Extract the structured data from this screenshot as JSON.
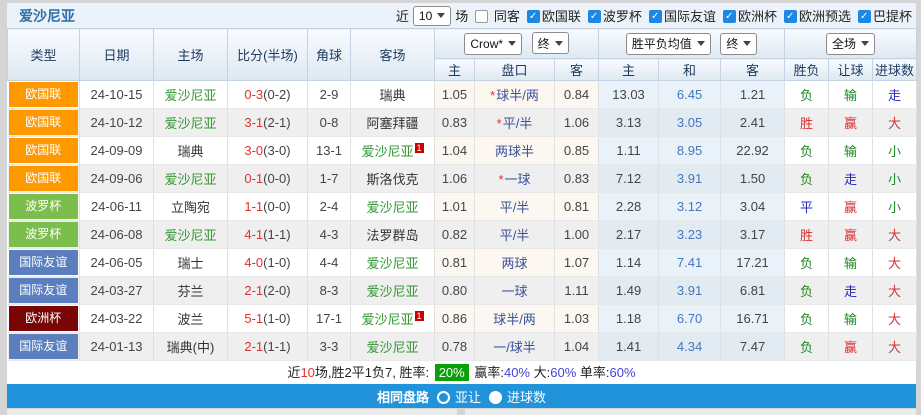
{
  "header": {
    "title": "爱沙尼亚"
  },
  "filters": {
    "recent_label": "近",
    "recent_count": "10",
    "recent_suffix": "场",
    "same_away": {
      "label": "同客",
      "checked": false
    },
    "leagues": [
      {
        "label": "欧国联",
        "checked": true
      },
      {
        "label": "波罗杯",
        "checked": true
      },
      {
        "label": "国际友谊",
        "checked": true
      },
      {
        "label": "欧洲杯",
        "checked": true
      },
      {
        "label": "欧洲预选",
        "checked": true
      },
      {
        "label": "巴提杯",
        "checked": true
      }
    ]
  },
  "selectors": {
    "asia_company": "Crow*",
    "asia_time": "终",
    "europe_mode": "胜平负均值",
    "europe_time": "终",
    "scope": "全场"
  },
  "columns": [
    "类型",
    "日期",
    "主场",
    "比分(半场)",
    "角球",
    "客场",
    "主",
    "盘口",
    "客",
    "主",
    "和",
    "客",
    "胜负",
    "让球",
    "进球数"
  ],
  "league_colors": {
    "欧国联": "#FF9900",
    "波罗杯": "#7CBE4B",
    "国际友谊": "#5B7FBE",
    "欧洲杯": "#7A0505"
  },
  "result_colors": {
    "g": "#1F8A1F",
    "r": "#D93030",
    "b": "#2525C0"
  },
  "rows": [
    {
      "type": "欧国联",
      "date": "24-10-15",
      "home": "爱沙尼亚",
      "home_green": true,
      "score": "0-3",
      "half": "(0-2)",
      "corner": "2-9",
      "away": "瑞典",
      "away_green": false,
      "red_card": "",
      "asia_home": "1.05",
      "star": "*",
      "line": "球半/两",
      "asia_away": "0.84",
      "eu_home": "13.03",
      "eu_draw": "6.45",
      "eu_away": "1.21",
      "result": "负",
      "result_c": "g",
      "handicap": "输",
      "handicap_c": "g",
      "goals": "走",
      "goals_c": "b"
    },
    {
      "type": "欧国联",
      "date": "24-10-12",
      "home": "爱沙尼亚",
      "home_green": true,
      "score": "3-1",
      "half": "(2-1)",
      "corner": "0-8",
      "away": "阿塞拜疆",
      "away_green": false,
      "red_card": "",
      "asia_home": "0.83",
      "star": "*",
      "line": "平/半",
      "asia_away": "1.06",
      "eu_home": "3.13",
      "eu_draw": "3.05",
      "eu_away": "2.41",
      "result": "胜",
      "result_c": "r",
      "handicap": "赢",
      "handicap_c": "r",
      "goals": "大",
      "goals_c": "r"
    },
    {
      "type": "欧国联",
      "date": "24-09-09",
      "home": "瑞典",
      "home_green": false,
      "score": "3-0",
      "half": "(3-0)",
      "corner": "13-1",
      "away": "爱沙尼亚",
      "away_green": true,
      "red_card": "1",
      "asia_home": "1.04",
      "star": "",
      "line": "两球半",
      "asia_away": "0.85",
      "eu_home": "1.11",
      "eu_draw": "8.95",
      "eu_away": "22.92",
      "result": "负",
      "result_c": "g",
      "handicap": "输",
      "handicap_c": "g",
      "goals": "小",
      "goals_c": "g"
    },
    {
      "type": "欧国联",
      "date": "24-09-06",
      "home": "爱沙尼亚",
      "home_green": true,
      "score": "0-1",
      "half": "(0-0)",
      "corner": "1-7",
      "away": "斯洛伐克",
      "away_green": false,
      "red_card": "",
      "asia_home": "1.06",
      "star": "*",
      "line": "一球",
      "asia_away": "0.83",
      "eu_home": "7.12",
      "eu_draw": "3.91",
      "eu_away": "1.50",
      "result": "负",
      "result_c": "g",
      "handicap": "走",
      "handicap_c": "b",
      "goals": "小",
      "goals_c": "g"
    },
    {
      "type": "波罗杯",
      "date": "24-06-11",
      "home": "立陶宛",
      "home_green": false,
      "score": "1-1",
      "half": "(0-0)",
      "corner": "2-4",
      "away": "爱沙尼亚",
      "away_green": true,
      "red_card": "",
      "asia_home": "1.01",
      "star": "",
      "line": "平/半",
      "asia_away": "0.81",
      "eu_home": "2.28",
      "eu_draw": "3.12",
      "eu_away": "3.04",
      "result": "平",
      "result_c": "b",
      "handicap": "赢",
      "handicap_c": "r",
      "goals": "小",
      "goals_c": "g"
    },
    {
      "type": "波罗杯",
      "date": "24-06-08",
      "home": "爱沙尼亚",
      "home_green": true,
      "score": "4-1",
      "half": "(1-1)",
      "corner": "4-3",
      "away": "法罗群岛",
      "away_green": false,
      "red_card": "",
      "asia_home": "0.82",
      "star": "",
      "line": "平/半",
      "asia_away": "1.00",
      "eu_home": "2.17",
      "eu_draw": "3.23",
      "eu_away": "3.17",
      "result": "胜",
      "result_c": "r",
      "handicap": "赢",
      "handicap_c": "r",
      "goals": "大",
      "goals_c": "r"
    },
    {
      "type": "国际友谊",
      "date": "24-06-05",
      "home": "瑞士",
      "home_green": false,
      "score": "4-0",
      "half": "(1-0)",
      "corner": "4-4",
      "away": "爱沙尼亚",
      "away_green": true,
      "red_card": "",
      "asia_home": "0.81",
      "star": "",
      "line": "两球",
      "asia_away": "1.07",
      "eu_home": "1.14",
      "eu_draw": "7.41",
      "eu_away": "17.21",
      "result": "负",
      "result_c": "g",
      "handicap": "输",
      "handicap_c": "g",
      "goals": "大",
      "goals_c": "r"
    },
    {
      "type": "国际友谊",
      "date": "24-03-27",
      "home": "芬兰",
      "home_green": false,
      "score": "2-1",
      "half": "(2-0)",
      "corner": "8-3",
      "away": "爱沙尼亚",
      "away_green": true,
      "red_card": "",
      "asia_home": "0.80",
      "star": "",
      "line": "一球",
      "asia_away": "1.11",
      "eu_home": "1.49",
      "eu_draw": "3.91",
      "eu_away": "6.81",
      "result": "负",
      "result_c": "g",
      "handicap": "走",
      "handicap_c": "b",
      "goals": "大",
      "goals_c": "r"
    },
    {
      "type": "欧洲杯",
      "date": "24-03-22",
      "home": "波兰",
      "home_green": false,
      "score": "5-1",
      "half": "(1-0)",
      "corner": "17-1",
      "away": "爱沙尼亚",
      "away_green": true,
      "red_card": "1",
      "asia_home": "0.86",
      "star": "",
      "line": "球半/两",
      "asia_away": "1.03",
      "eu_home": "1.18",
      "eu_draw": "6.70",
      "eu_away": "16.71",
      "result": "负",
      "result_c": "g",
      "handicap": "输",
      "handicap_c": "g",
      "goals": "大",
      "goals_c": "r"
    },
    {
      "type": "国际友谊",
      "date": "24-01-13",
      "home": "瑞典(中)",
      "home_green": false,
      "score": "2-1",
      "half": "(1-1)",
      "corner": "3-3",
      "away": "爱沙尼亚",
      "away_green": true,
      "red_card": "",
      "asia_home": "0.78",
      "star": "",
      "line": "一/球半",
      "asia_away": "1.04",
      "eu_home": "1.41",
      "eu_draw": "4.34",
      "eu_away": "7.47",
      "result": "负",
      "result_c": "g",
      "handicap": "赢",
      "handicap_c": "r",
      "goals": "大",
      "goals_c": "r"
    }
  ],
  "summary": {
    "part1": "近",
    "count": "10",
    "part2": "场,胜2平1负7, 胜率:",
    "win_rate": "20%",
    "win_label": "赢率:",
    "win_pct": "40%",
    "big_label": "大:",
    "big_pct": "60%",
    "single_label": "单率:",
    "single_pct": "60%"
  },
  "bottom_bar": {
    "label": "相同盘路",
    "options": [
      {
        "label": "亚让",
        "selected": false
      },
      {
        "label": "进球数",
        "selected": true
      }
    ]
  }
}
